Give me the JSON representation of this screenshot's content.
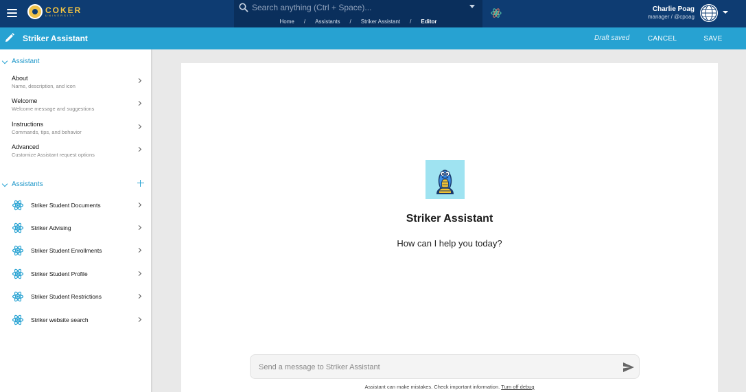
{
  "topbar": {
    "logo_text": "COKER",
    "logo_subtext": "UNIVERSITY",
    "search_placeholder": "Search anything (Ctrl + Space)...",
    "breadcrumb": [
      "Home",
      "Assistants",
      "Striker Assistant",
      "Editor"
    ],
    "breadcrumb_separator": "/",
    "user_name": "Charlie Poag",
    "user_role": "manager / @cpoag"
  },
  "subbar": {
    "title": "Striker Assistant",
    "draft_status": "Draft saved",
    "cancel_label": "CANCEL",
    "save_label": "SAVE"
  },
  "sidebar": {
    "assistant_section": {
      "label": "Assistant",
      "items": [
        {
          "title": "About",
          "desc": "Name, description, and icon"
        },
        {
          "title": "Welcome",
          "desc": "Welcome message and suggestions"
        },
        {
          "title": "Instructions",
          "desc": "Commands, tips, and behavior"
        },
        {
          "title": "Advanced",
          "desc": "Customize Assistant request options"
        }
      ]
    },
    "assistants_section": {
      "label": "Assistants",
      "items": [
        {
          "name": "Striker Student Documents"
        },
        {
          "name": "Striker Advising"
        },
        {
          "name": "Striker Student Enrollments"
        },
        {
          "name": "Striker Student Profile"
        },
        {
          "name": "Striker Student Restrictions"
        },
        {
          "name": "Striker website search"
        }
      ]
    }
  },
  "main": {
    "assistant_name": "Striker Assistant",
    "greeting": "How can I help you today?",
    "message_placeholder": "Send a message to Striker Assistant",
    "disclaimer": "Assistant can make mistakes. Check important information.",
    "debug_link": "Turn off debug"
  },
  "colors": {
    "topbar": "#0e3c72",
    "accent": "#27a2d2",
    "logo": "#f5c542"
  }
}
